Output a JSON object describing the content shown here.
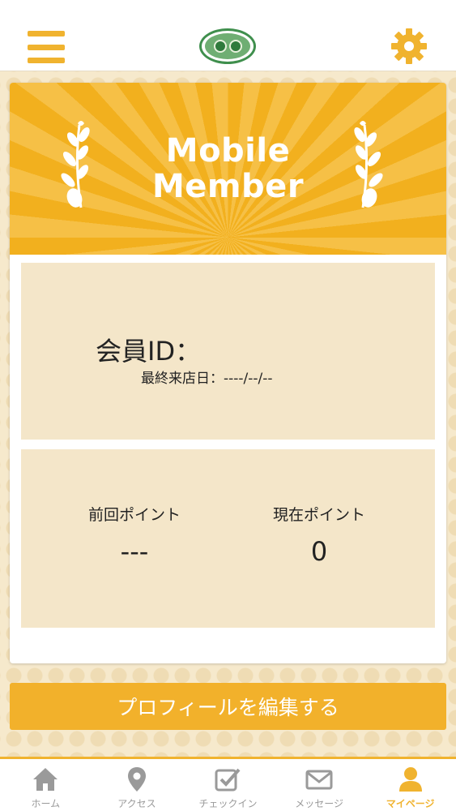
{
  "header": {
    "menu_icon": "hamburger-menu-icon",
    "logo_icon": "cat-logo-icon",
    "settings_icon": "gear-icon",
    "accent_color": "#f0b32f"
  },
  "banner": {
    "title_line1": "Mobile",
    "title_line2": "Member",
    "background_color": "#f2b01e"
  },
  "member": {
    "id_label": "会員ID：",
    "last_visit_label": "最終来店日：----/--/--"
  },
  "points": {
    "previous_label": "前回ポイント",
    "previous_value": "---",
    "current_label": "現在ポイント",
    "current_value": "0"
  },
  "profile_button": {
    "label": "プロフィールを編集する"
  },
  "tabbar": {
    "tabs": [
      {
        "label": "ホーム",
        "icon": "home-icon",
        "active": false
      },
      {
        "label": "アクセス",
        "icon": "location-pin-icon",
        "active": false
      },
      {
        "label": "チェックイン",
        "icon": "checkbox-icon",
        "active": false
      },
      {
        "label": "メッセージ",
        "icon": "envelope-icon",
        "active": false
      },
      {
        "label": "マイページ",
        "icon": "user-icon",
        "active": true
      }
    ]
  }
}
